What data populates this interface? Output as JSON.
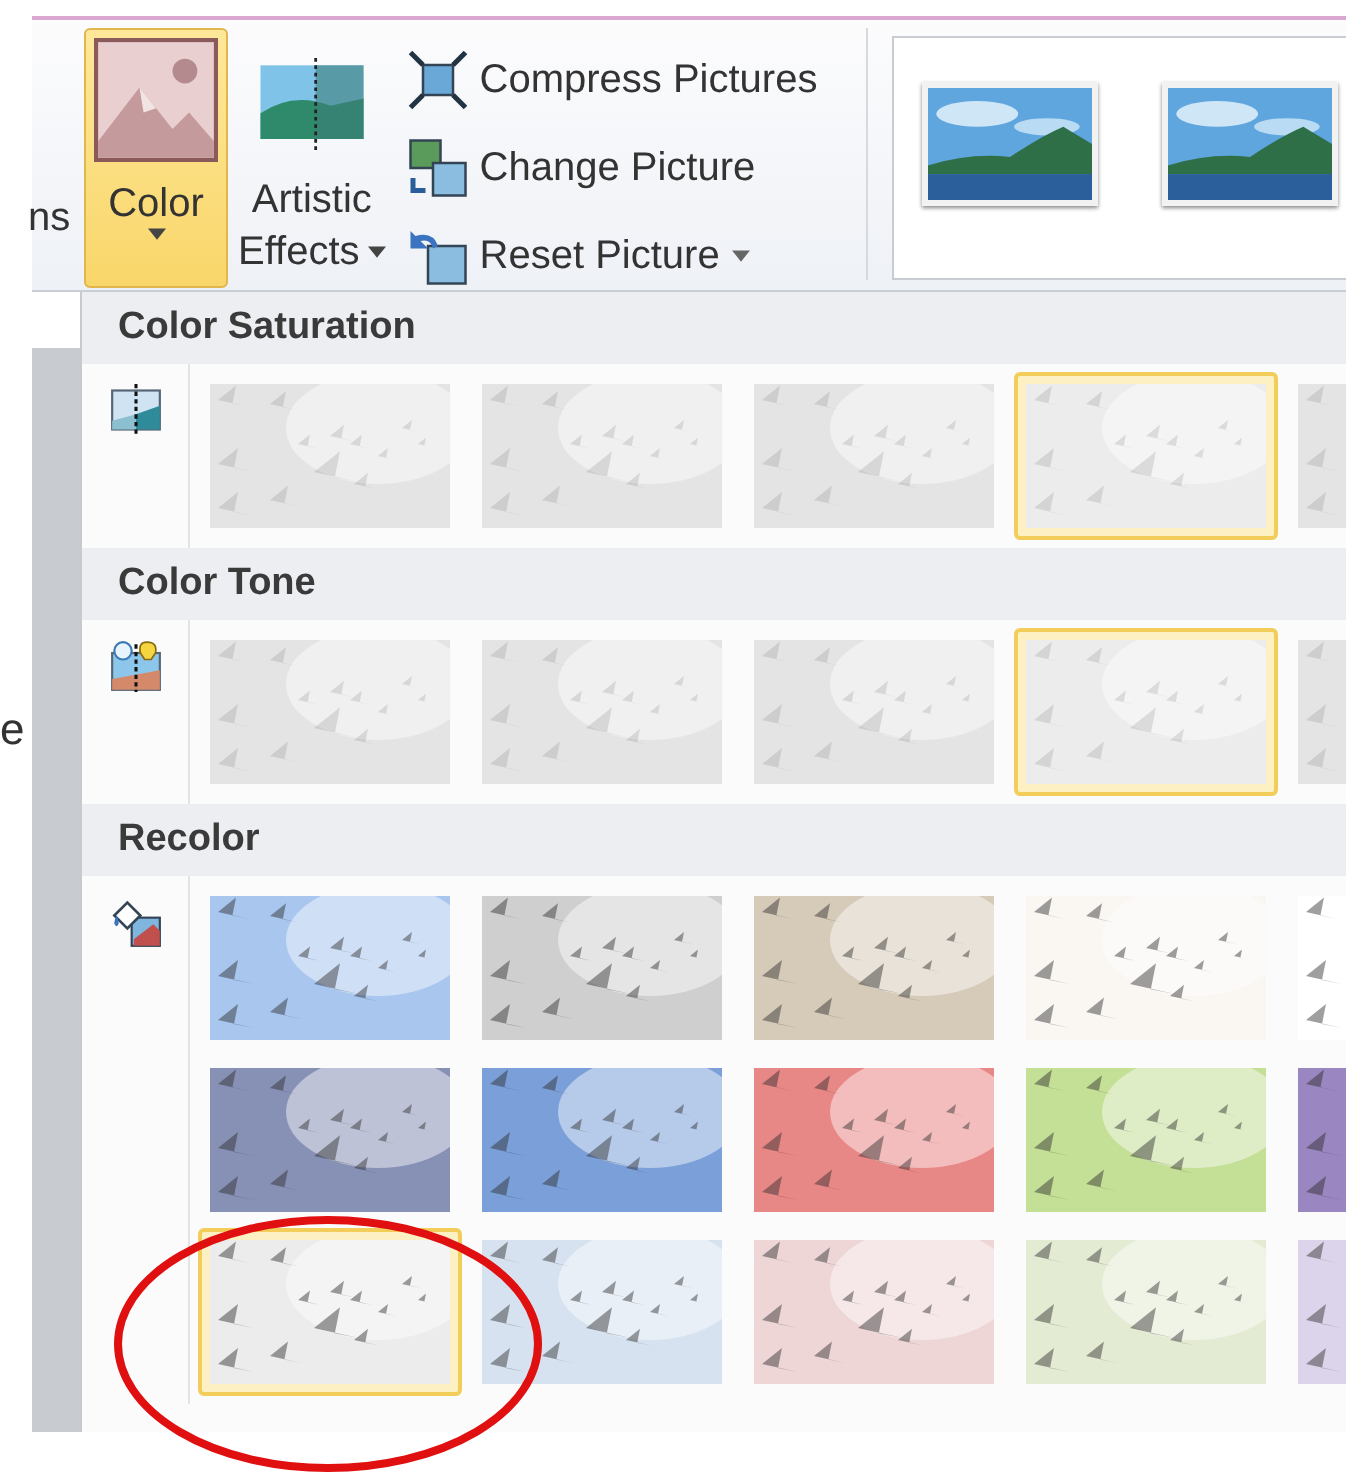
{
  "ribbon": {
    "cut_label": "ns",
    "color_button": {
      "label": "Color",
      "selected": true,
      "dropdown": true
    },
    "artistic_button": {
      "label_line_1": "Artistic",
      "label_line_2": "Effects",
      "dropdown": true
    },
    "small_buttons": [
      {
        "kind": "compress",
        "label": "Compress Pictures",
        "dropdown": false
      },
      {
        "kind": "change",
        "label": "Change Picture",
        "dropdown": false
      },
      {
        "kind": "reset",
        "label": "Reset Picture",
        "dropdown": true
      }
    ]
  },
  "left_edge_text": "e",
  "color_menu": {
    "sections": [
      {
        "title": "Color Saturation",
        "kind": "saturation",
        "rows": [
          [
            {
              "selected": false,
              "color": "#e4e4e4"
            },
            {
              "selected": false,
              "color": "#e4e4e4"
            },
            {
              "selected": false,
              "color": "#e4e4e4"
            },
            {
              "selected": true,
              "color": "#ececec"
            },
            {
              "selected": false,
              "color": "#e4e4e4"
            }
          ]
        ]
      },
      {
        "title": "Color Tone",
        "kind": "tone",
        "rows": [
          [
            {
              "selected": false,
              "color": "#e4e4e4"
            },
            {
              "selected": false,
              "color": "#e4e4e4"
            },
            {
              "selected": false,
              "color": "#e4e4e4"
            },
            {
              "selected": true,
              "color": "#ececec"
            },
            {
              "selected": false,
              "color": "#e4e4e4"
            }
          ]
        ]
      },
      {
        "title": "Recolor",
        "kind": "recolor",
        "rows": [
          [
            {
              "selected": false,
              "color": "#a8c6ee"
            },
            {
              "selected": false,
              "color": "#cfcfcf"
            },
            {
              "selected": false,
              "color": "#d6cab8"
            },
            {
              "selected": false,
              "color": "#faf6f2"
            },
            {
              "selected": false,
              "color": "#ffffff"
            }
          ],
          [
            {
              "selected": false,
              "color": "#8791b5"
            },
            {
              "selected": false,
              "color": "#7b9fd9"
            },
            {
              "selected": false,
              "color": "#e88886"
            },
            {
              "selected": false,
              "color": "#c4df96"
            },
            {
              "selected": false,
              "color": "#9a86c0"
            }
          ],
          [
            {
              "selected": true,
              "color": "#ececec"
            },
            {
              "selected": false,
              "color": "#d6e2ef"
            },
            {
              "selected": false,
              "color": "#eed6d6"
            },
            {
              "selected": false,
              "color": "#e4ebd3"
            },
            {
              "selected": false,
              "color": "#dcd4ea"
            }
          ]
        ]
      }
    ]
  }
}
